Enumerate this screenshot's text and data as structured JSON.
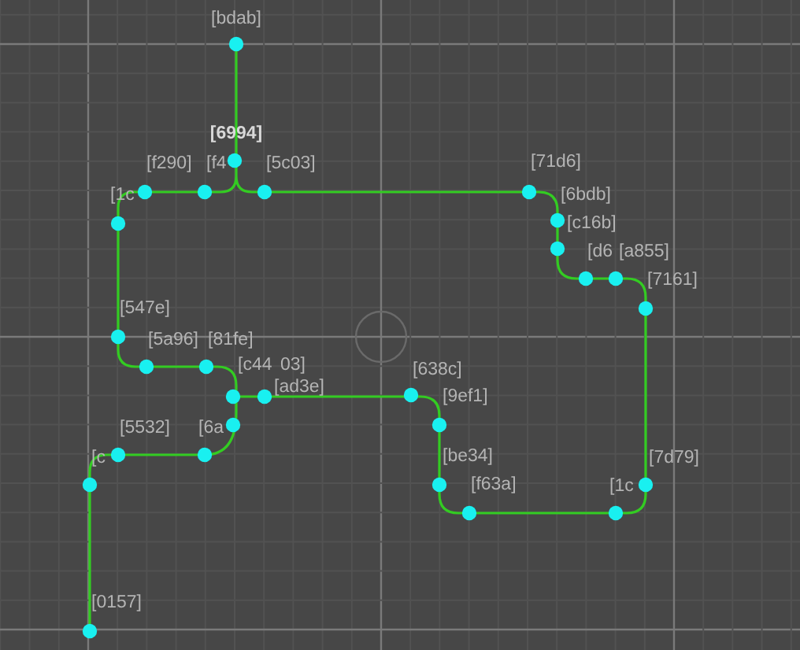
{
  "viewport": {
    "labels": [
      {
        "text": "[bdab]",
        "bold": false
      },
      {
        "text": "[6994]",
        "bold": true
      },
      {
        "text": "[f290]",
        "bold": false
      },
      {
        "text": "[f4",
        "bold": false
      },
      {
        "text": "[5c03]",
        "bold": false
      },
      {
        "text": "[1c",
        "bold": false
      },
      {
        "text": "[71d6]",
        "bold": false
      },
      {
        "text": "[6bdb]",
        "bold": false
      },
      {
        "text": "[c16b]",
        "bold": false
      },
      {
        "text": "[d6",
        "bold": false
      },
      {
        "text": "[a855]",
        "bold": false
      },
      {
        "text": "[7161]",
        "bold": false
      },
      {
        "text": "[547e]",
        "bold": false
      },
      {
        "text": "[5a96]",
        "bold": false
      },
      {
        "text": "[81fe]",
        "bold": false
      },
      {
        "text": "[c44",
        "bold": false
      },
      {
        "text": "03]",
        "bold": false
      },
      {
        "text": "[ad3e]",
        "bold": false
      },
      {
        "text": "[638c]",
        "bold": false
      },
      {
        "text": "[9ef1]",
        "bold": false
      },
      {
        "text": "[be34]",
        "bold": false
      },
      {
        "text": "[f63a]",
        "bold": false
      },
      {
        "text": "[7d79]",
        "bold": false
      },
      {
        "text": "[1c",
        "bold": false
      },
      {
        "text": "[5532]",
        "bold": false
      },
      {
        "text": "[6a",
        "bold": false
      },
      {
        "text": "[c",
        "bold": false
      },
      {
        "text": "[0157]",
        "bold": false
      }
    ]
  }
}
